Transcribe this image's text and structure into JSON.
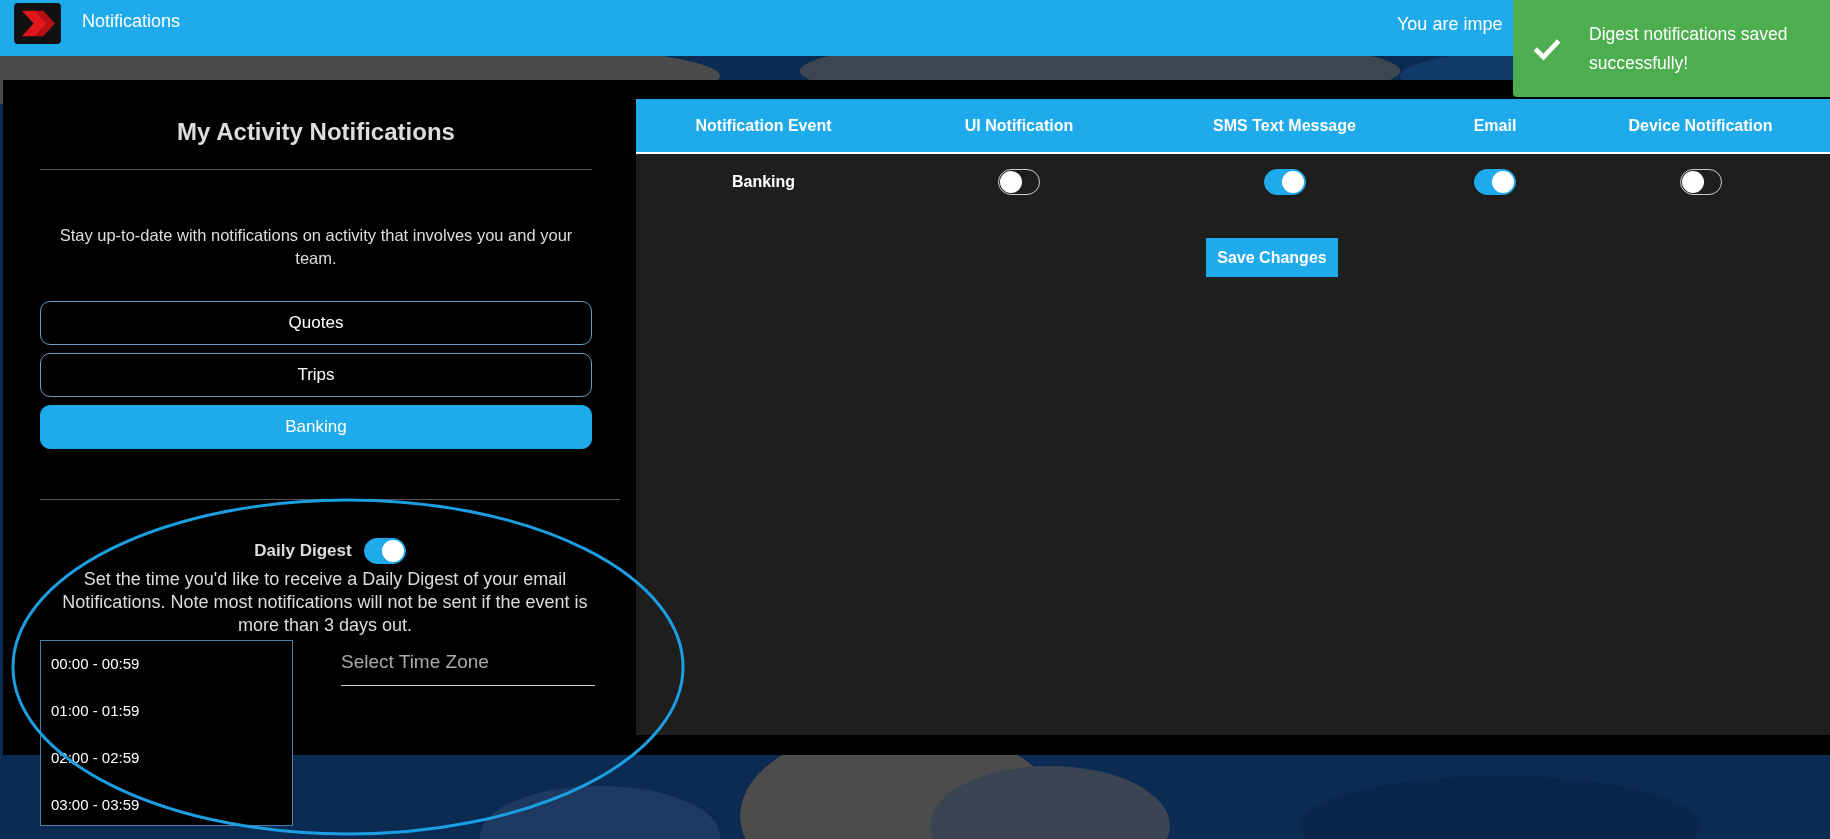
{
  "header": {
    "title": "Notifications",
    "impersonation_text": "You are impe"
  },
  "toast": {
    "message": "Digest notifications saved successfully!"
  },
  "sidebar": {
    "title": "My Activity Notifications",
    "description": "Stay up-to-date with notifications on activity that involves you and your team.",
    "categories": [
      {
        "label": "Quotes",
        "selected": false
      },
      {
        "label": "Trips",
        "selected": false
      },
      {
        "label": "Banking",
        "selected": true
      }
    ]
  },
  "daily_digest": {
    "label": "Daily Digest",
    "on": true,
    "description": "Set the time you'd like to receive a Daily Digest of your email Notifications. Note most notifications will not be sent if the event is more than 3 days out.",
    "time_options": [
      "00:00 - 00:59",
      "01:00 - 01:59",
      "02:00 - 02:59",
      "03:00 - 03:59"
    ],
    "time_zone": {
      "placeholder": "Select Time Zone"
    }
  },
  "table": {
    "columns": [
      "Notification Event",
      "UI Notification",
      "SMS Text Message",
      "Email",
      "Device Notification"
    ],
    "rows": [
      {
        "event": "Banking",
        "toggles": [
          {
            "on": false
          },
          {
            "on": true
          },
          {
            "on": true
          },
          {
            "on": false
          }
        ]
      }
    ]
  },
  "save_button": "Save Changes"
}
